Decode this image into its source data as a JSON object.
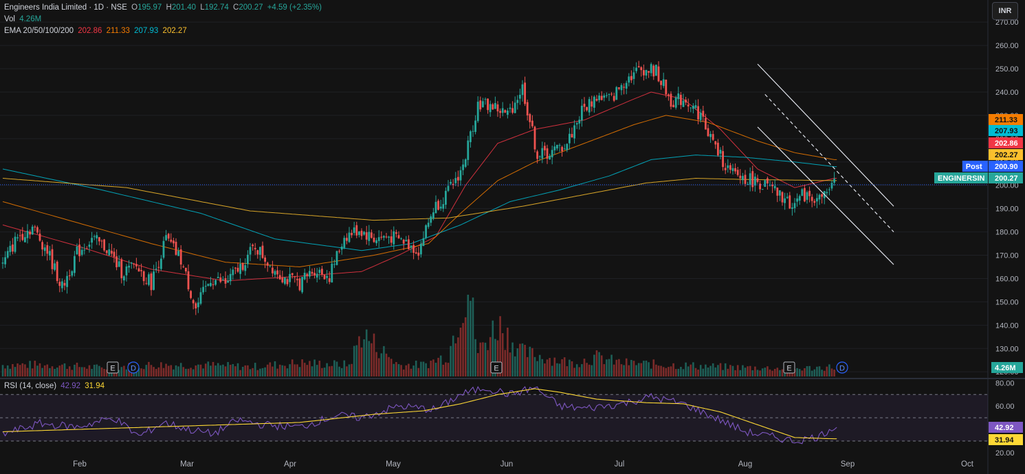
{
  "header": {
    "symbol": "Engineers India Limited · 1D · NSE",
    "o_label": "O",
    "o_value": "195.97",
    "h_label": "H",
    "h_value": "201.40",
    "l_label": "L",
    "l_value": "192.74",
    "c_label": "C",
    "c_value": "200.27",
    "change": "+4.59 (+2.35%)",
    "vol_label": "Vol",
    "vol_value": "4.26M",
    "ema_label": "EMA 20/50/100/200",
    "ema20": "202.86",
    "ema50": "211.33",
    "ema100": "207.93",
    "ema200": "202.27",
    "rsi_label": "RSI (14, close)",
    "rsi_value": "42.92",
    "rsi_ma_value": "31.94"
  },
  "toolbar": {
    "currency": "INR"
  },
  "colors": {
    "background": "#131313",
    "up": "#26a69a",
    "down": "#ef5350",
    "ema20": "#f23645",
    "ema50": "#f57c00",
    "ema100": "#00bcd4",
    "ema200": "#fbc02d",
    "rsi": "#7e57c2",
    "rsi_ma": "#fdd835",
    "grid": "#1f2025"
  },
  "chart_data": [
    {
      "type": "candlestick",
      "title": "Engineers India Limited · 1D · NSE",
      "ylim": [
        118,
        273
      ],
      "y_ticks": [
        120,
        130,
        140,
        150,
        160,
        170,
        180,
        190,
        200,
        210,
        220,
        230,
        240,
        250,
        260,
        270
      ],
      "y_tick_labels": [
        "120.00",
        "130.00",
        "140.00",
        "150.00",
        "160.00",
        "170.00",
        "180.00",
        "190.00",
        "200.00",
        "210.00",
        "220.00",
        "230.00",
        "240.00",
        "250.00",
        "260.00",
        "270.00"
      ],
      "x_labels": [
        "Feb",
        "Mar",
        "Apr",
        "May",
        "Jun",
        "Jul",
        "Aug",
        "Sep",
        "Oct"
      ],
      "price_markers": [
        {
          "label": "211.33",
          "value": 211.33,
          "color": "#f57c00"
        },
        {
          "label": "207.93",
          "value": 207.93,
          "color": "#00bcd4"
        },
        {
          "label": "202.86",
          "value": 202.86,
          "color": "#f23645"
        },
        {
          "label": "202.27",
          "value": 202.27,
          "color": "#fbc02d"
        },
        {
          "label": "200.90",
          "value": 200.9,
          "color": "#2962ff",
          "tag": "Post"
        },
        {
          "label": "200.27",
          "value": 200.27,
          "color": "#26a69a",
          "tag": "ENGINERSIN"
        }
      ],
      "volume_marker": "4.26M",
      "event_markers": [
        "E",
        "D",
        "E",
        "E",
        "D"
      ],
      "close_anchors": [
        [
          0,
          166
        ],
        [
          6,
          178
        ],
        [
          12,
          182
        ],
        [
          18,
          172
        ],
        [
          24,
          156
        ],
        [
          30,
          171
        ],
        [
          36,
          177
        ],
        [
          42,
          173
        ],
        [
          48,
          163
        ],
        [
          54,
          165
        ],
        [
          60,
          158
        ],
        [
          66,
          177
        ],
        [
          72,
          168
        ],
        [
          78,
          147
        ],
        [
          84,
          160
        ],
        [
          90,
          158
        ],
        [
          96,
          165
        ],
        [
          102,
          174
        ],
        [
          108,
          166
        ],
        [
          114,
          160
        ],
        [
          120,
          158
        ],
        [
          126,
          164
        ],
        [
          132,
          161
        ],
        [
          138,
          178
        ],
        [
          144,
          181
        ],
        [
          150,
          177
        ],
        [
          156,
          178
        ],
        [
          162,
          176
        ],
        [
          168,
          172
        ],
        [
          174,
          190
        ],
        [
          180,
          197
        ],
        [
          186,
          208
        ],
        [
          192,
          235
        ],
        [
          198,
          234
        ],
        [
          204,
          230
        ],
        [
          210,
          242
        ],
        [
          216,
          213
        ],
        [
          222,
          214
        ],
        [
          228,
          218
        ],
        [
          234,
          232
        ],
        [
          240,
          238
        ],
        [
          246,
          237
        ],
        [
          252,
          246
        ],
        [
          258,
          250
        ],
        [
          264,
          249
        ],
        [
          270,
          236
        ],
        [
          276,
          237
        ],
        [
          282,
          230
        ],
        [
          288,
          216
        ],
        [
          294,
          205
        ],
        [
          300,
          203
        ],
        [
          306,
          201
        ],
        [
          312,
          197
        ],
        [
          318,
          192
        ],
        [
          324,
          196
        ],
        [
          330,
          194
        ],
        [
          336,
          200.27
        ]
      ],
      "volume_anchors": [
        [
          0,
          0.12
        ],
        [
          20,
          0.12
        ],
        [
          40,
          0.09
        ],
        [
          60,
          0.12
        ],
        [
          80,
          0.12
        ],
        [
          100,
          0.1
        ],
        [
          120,
          0.14
        ],
        [
          140,
          0.12
        ],
        [
          145,
          0.45
        ],
        [
          160,
          0.12
        ],
        [
          170,
          0.12
        ],
        [
          180,
          0.22
        ],
        [
          188,
          1.0
        ],
        [
          192,
          0.25
        ],
        [
          200,
          0.55
        ],
        [
          210,
          0.25
        ],
        [
          230,
          0.14
        ],
        [
          240,
          0.2
        ],
        [
          250,
          0.14
        ],
        [
          270,
          0.12
        ],
        [
          290,
          0.1
        ],
        [
          320,
          0.08
        ],
        [
          336,
          0.1
        ]
      ],
      "ema_series": [
        {
          "name": "EMA 20",
          "color": "#f23645",
          "points": [
            [
              0,
              183
            ],
            [
              30,
              174
            ],
            [
              60,
              164
            ],
            [
              90,
              159
            ],
            [
              120,
              161
            ],
            [
              145,
              163
            ],
            [
              160,
              170
            ],
            [
              175,
              178
            ],
            [
              187,
              200
            ],
            [
              200,
              218
            ],
            [
              215,
              224
            ],
            [
              235,
              228
            ],
            [
              255,
              237
            ],
            [
              262,
              240
            ],
            [
              275,
              237
            ],
            [
              290,
              224
            ],
            [
              305,
              207
            ],
            [
              320,
              199
            ],
            [
              336,
              203
            ]
          ]
        },
        {
          "name": "EMA 50",
          "color": "#f57c00",
          "points": [
            [
              0,
              193
            ],
            [
              30,
              184
            ],
            [
              60,
              175
            ],
            [
              90,
              167
            ],
            [
              120,
              165
            ],
            [
              150,
              170
            ],
            [
              172,
              175
            ],
            [
              185,
              188
            ],
            [
              200,
              202
            ],
            [
              215,
              210
            ],
            [
              235,
              218
            ],
            [
              255,
              226
            ],
            [
              268,
              230
            ],
            [
              285,
              227
            ],
            [
              305,
              219
            ],
            [
              320,
              214
            ],
            [
              336,
              211
            ]
          ]
        },
        {
          "name": "EMA 100",
          "color": "#00bcd4",
          "points": [
            [
              0,
              207
            ],
            [
              40,
              198
            ],
            [
              80,
              188
            ],
            [
              110,
              177
            ],
            [
              145,
              172
            ],
            [
              165,
              175
            ],
            [
              185,
              183
            ],
            [
              205,
              193
            ],
            [
              225,
              198
            ],
            [
              245,
              204
            ],
            [
              262,
              211
            ],
            [
              280,
              213
            ],
            [
              300,
              212
            ],
            [
              320,
              210
            ],
            [
              336,
              208
            ]
          ]
        },
        {
          "name": "EMA 200",
          "color": "#fbc02d",
          "points": [
            [
              0,
              203
            ],
            [
              50,
              199
            ],
            [
              100,
              189
            ],
            [
              150,
              185
            ],
            [
              180,
              186
            ],
            [
              210,
              191
            ],
            [
              235,
              196
            ],
            [
              260,
              201
            ],
            [
              280,
              203
            ],
            [
              300,
              202.5
            ],
            [
              336,
              202
            ]
          ]
        }
      ],
      "trend_lines": [
        {
          "from": [
            305,
            252
          ],
          "to": [
            360,
            191
          ]
        },
        {
          "from": [
            305,
            225
          ],
          "to": [
            360,
            166
          ]
        },
        {
          "from": [
            308,
            239
          ],
          "to": [
            360,
            180
          ],
          "dashed": true
        }
      ]
    },
    {
      "type": "line",
      "title": "RSI (14, close)",
      "ylim": [
        17,
        82
      ],
      "y_ticks": [
        20,
        40,
        60,
        80
      ],
      "y_tick_labels": [
        "20.00",
        "40.00",
        "60.00",
        "80.00"
      ],
      "bands": [
        30,
        50,
        70
      ],
      "markers": [
        {
          "label": "42.92",
          "value": 42.92,
          "color": "#7e57c2"
        },
        {
          "label": "31.94",
          "value": 31.94,
          "color": "#fdd835"
        }
      ],
      "series": [
        {
          "name": "RSI",
          "color": "#7e57c2",
          "points": [
            [
              0,
              36
            ],
            [
              15,
              45
            ],
            [
              30,
              42
            ],
            [
              45,
              50
            ],
            [
              55,
              34
            ],
            [
              65,
              46
            ],
            [
              75,
              40
            ],
            [
              85,
              36
            ],
            [
              95,
              48
            ],
            [
              105,
              44
            ],
            [
              120,
              42
            ],
            [
              135,
              52
            ],
            [
              145,
              50
            ],
            [
              160,
              60
            ],
            [
              175,
              57
            ],
            [
              185,
              70
            ],
            [
              195,
              76
            ],
            [
              205,
              70
            ],
            [
              215,
              76
            ],
            [
              225,
              60
            ],
            [
              235,
              58
            ],
            [
              250,
              62
            ],
            [
              262,
              68
            ],
            [
              275,
              62
            ],
            [
              290,
              48
            ],
            [
              300,
              38
            ],
            [
              310,
              34
            ],
            [
              320,
              30
            ],
            [
              330,
              34
            ],
            [
              336,
              42.92
            ]
          ]
        },
        {
          "name": "RSI-based MA",
          "color": "#fdd835",
          "points": [
            [
              0,
              38
            ],
            [
              30,
              40
            ],
            [
              60,
              42
            ],
            [
              90,
              44
            ],
            [
              120,
              46
            ],
            [
              150,
              53
            ],
            [
              170,
              56
            ],
            [
              185,
              62
            ],
            [
              200,
              70
            ],
            [
              215,
              75
            ],
            [
              225,
              72
            ],
            [
              240,
              66
            ],
            [
              260,
              63
            ],
            [
              275,
              62
            ],
            [
              290,
              55
            ],
            [
              305,
              44
            ],
            [
              320,
              33
            ],
            [
              336,
              31.94
            ]
          ]
        }
      ]
    }
  ]
}
